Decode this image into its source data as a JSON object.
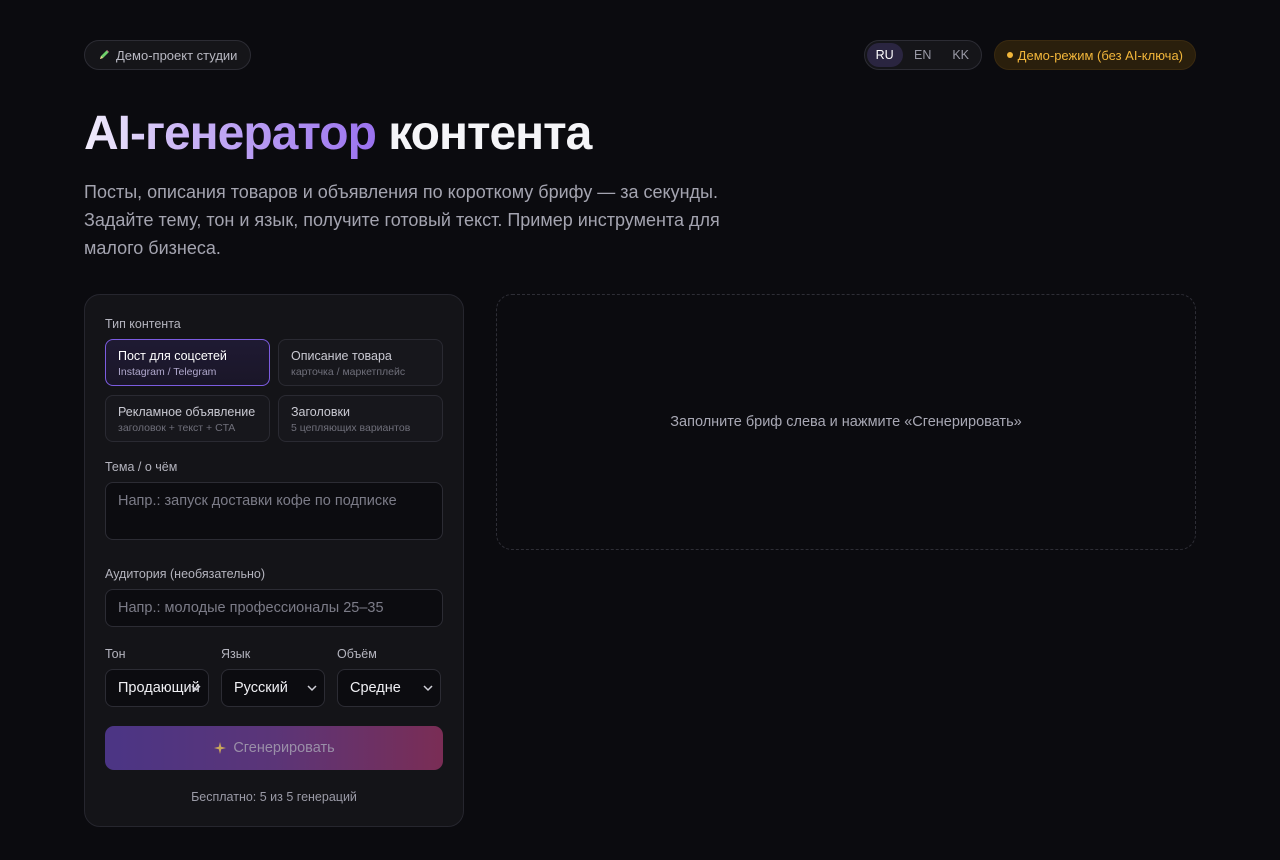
{
  "header": {
    "studio_label": "Демо-проект студии",
    "languages": [
      "RU",
      "EN",
      "KK"
    ],
    "active_language": "RU",
    "demo_badge": "Демо-режим (без AI-ключа)"
  },
  "hero": {
    "title_gradient": "AI-генератор",
    "title_plain": "контента",
    "subtitle": "Посты, описания товаров и объявления по короткому брифу — за секунды. Задайте тему, тон и язык, получите готовый текст. Пример инструмента для малого бизнеса."
  },
  "form": {
    "content_type_label": "Тип контента",
    "content_types": [
      {
        "title": "Пост для соцсетей",
        "subtitle": "Instagram / Telegram",
        "active": true
      },
      {
        "title": "Описание товара",
        "subtitle": "карточка / маркетплейс",
        "active": false
      },
      {
        "title": "Рекламное объявление",
        "subtitle": "заголовок + текст + CTA",
        "active": false
      },
      {
        "title": "Заголовки",
        "subtitle": "5 цепляющих вариантов",
        "active": false
      }
    ],
    "topic": {
      "label": "Тема / о чём",
      "placeholder": "Напр.: запуск доставки кофе по подписке",
      "value": ""
    },
    "audience": {
      "label": "Аудитория (необязательно)",
      "placeholder": "Напр.: молодые профессионалы 25–35",
      "value": ""
    },
    "tone": {
      "label": "Тон",
      "value": "Продающий"
    },
    "language": {
      "label": "Язык",
      "value": "Русский"
    },
    "length": {
      "label": "Объём",
      "value": "Средне"
    },
    "generate_button": "Сгенерировать",
    "quota": "Бесплатно: 5 из 5 генераций"
  },
  "output": {
    "empty_text": "Заполните бриф слева и нажмите «Сгенерировать»"
  },
  "colors": {
    "accent": "#7c5ce0",
    "badge": "#f2b63a",
    "background": "#0b0b0f"
  }
}
